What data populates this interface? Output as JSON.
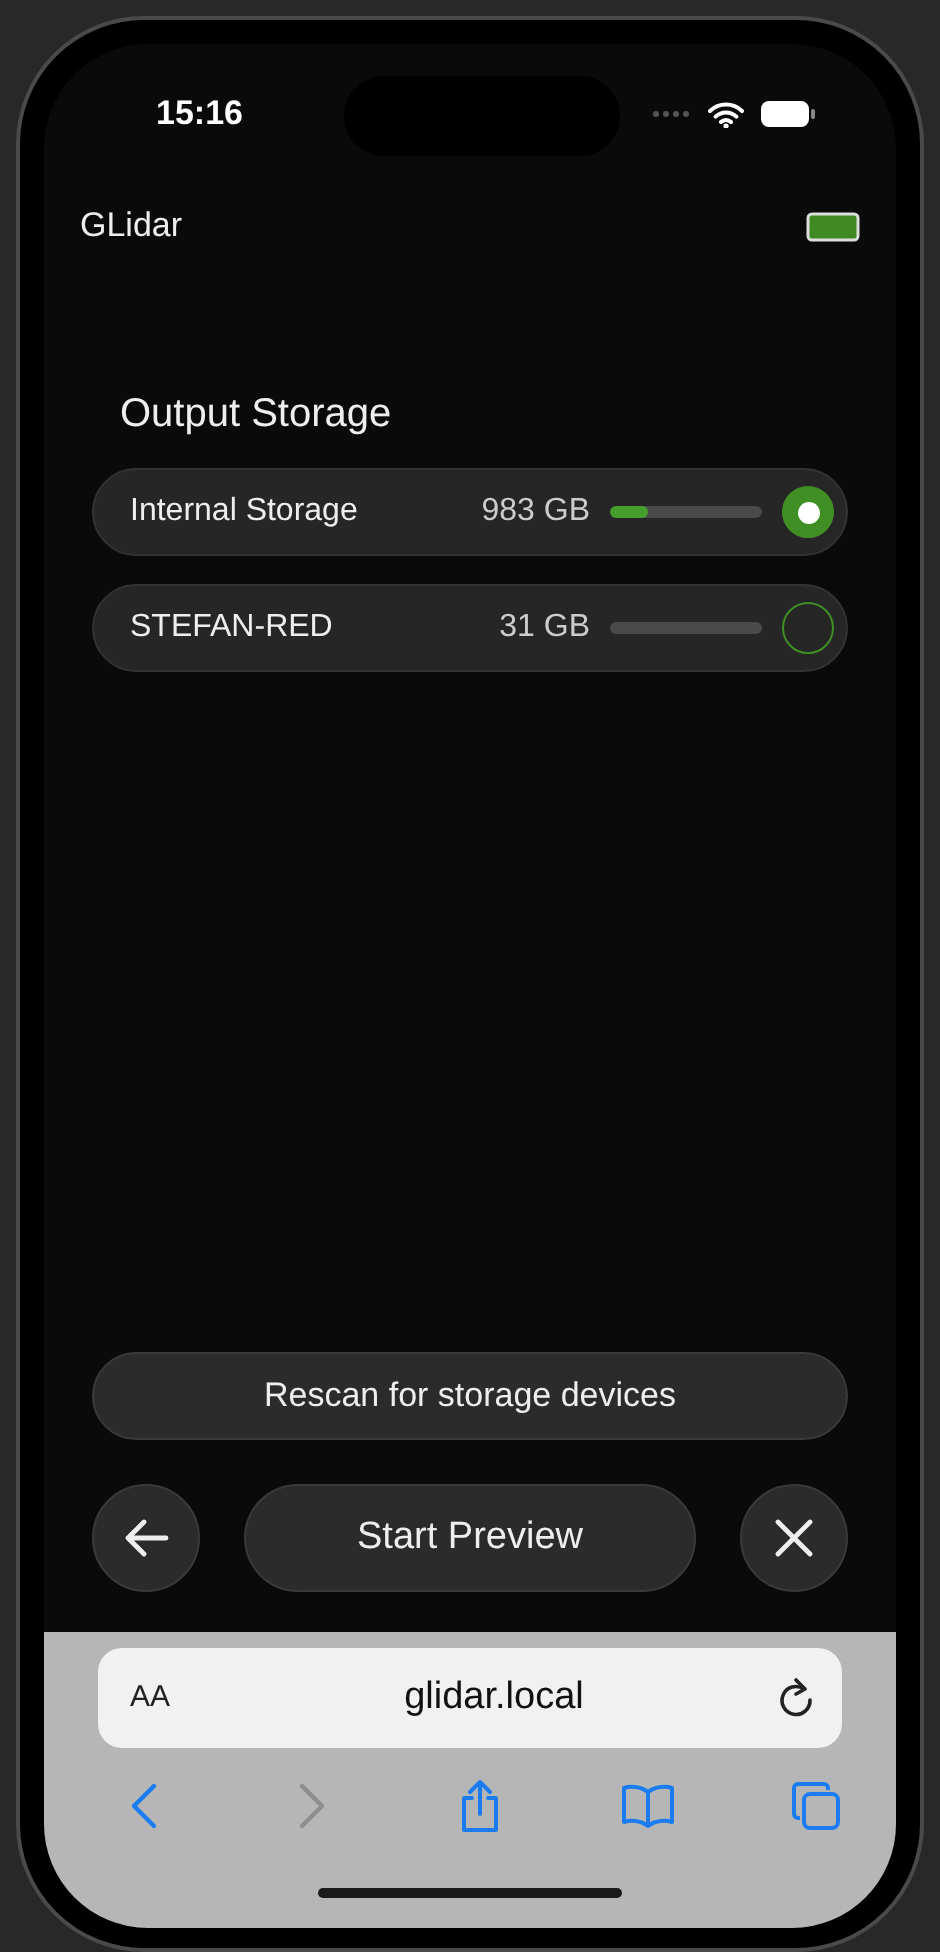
{
  "status_bar": {
    "time": "15:16"
  },
  "app": {
    "title": "GLidar"
  },
  "storage": {
    "title": "Output Storage",
    "devices": [
      {
        "name": "Internal Storage",
        "size": "983 GB",
        "level": 0.25,
        "selected": true
      },
      {
        "name": "STEFAN-RED",
        "size": "31 GB",
        "level": 0,
        "selected": false
      }
    ]
  },
  "buttons": {
    "rescan": "Rescan for storage devices",
    "start": "Start Preview"
  },
  "browser": {
    "text_size": "AA",
    "url": "glidar.local",
    "back_disabled": false,
    "forward_disabled": true
  }
}
